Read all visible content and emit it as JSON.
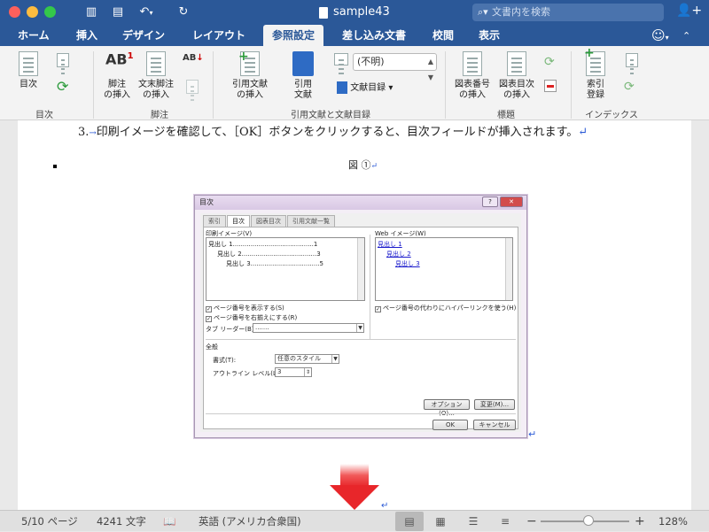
{
  "titlebar": {
    "title": "sample43",
    "search_placeholder": "文書内を検索"
  },
  "tabs": [
    "ホーム",
    "挿入",
    "デザイン",
    "レイアウト",
    "参照設定",
    "差し込み文書",
    "校閲",
    "表示"
  ],
  "active_tab": "参照設定",
  "ribbon": {
    "toc": {
      "label": "目次",
      "group": "目次"
    },
    "footnote": {
      "insert": "脚注\nの挿入",
      "endnote": "文末脚注\nの挿入",
      "group": "脚注"
    },
    "citation": {
      "insert": "引用文献\nの挿入",
      "bib": "引用\n文献",
      "style_value": "(不明)",
      "biblio": "文献目録",
      "group": "引用文献と文献目録"
    },
    "caption": {
      "insert": "図表番号\nの挿入",
      "tof": "図表目次\nの挿入",
      "group": "標題"
    },
    "index": {
      "mark": "索引\n登録",
      "group": "インデックス"
    }
  },
  "document": {
    "step_number": "3.",
    "step_text": "印刷イメージを確認して、［OK］ボタンをクリックすると、目次フィールドが挿入されます。",
    "figure_caption": "図 ①"
  },
  "dialog": {
    "title": "目次",
    "tabs": [
      "索引",
      "目次",
      "図表目次",
      "引用文献一覧"
    ],
    "print_preview_label": "印刷イメージ(V)",
    "print_lines": [
      "見出し 1.........................................1",
      "見出し 2......................................3",
      "見出し 3...................................5"
    ],
    "web_preview_label": "Web イメージ(W)",
    "web_lines": [
      "見出し 1",
      "見出し 2",
      "見出し 3"
    ],
    "cb_show_page": "ページ番号を表示する(S)",
    "cb_right_align": "ページ番号を右揃えにする(R)",
    "cb_hyperlink": "ページ番号の代わりにハイパーリンクを使う(H)",
    "tab_leader_label": "タブ リーダー(B):",
    "tab_leader_value": ".......",
    "general_label": "全般",
    "format_label": "書式(T):",
    "format_value": "任意のスタイル",
    "outline_label": "アウトライン レベル(L):",
    "outline_value": "3",
    "options_button": "オプション(O)...",
    "modify_button": "変更(M)...",
    "ok_button": "OK",
    "cancel_button": "キャンセル"
  },
  "status": {
    "page": "5/10 ページ",
    "words": "4241 文字",
    "language": "英語 (アメリカ合衆国)",
    "zoom": "128%"
  }
}
